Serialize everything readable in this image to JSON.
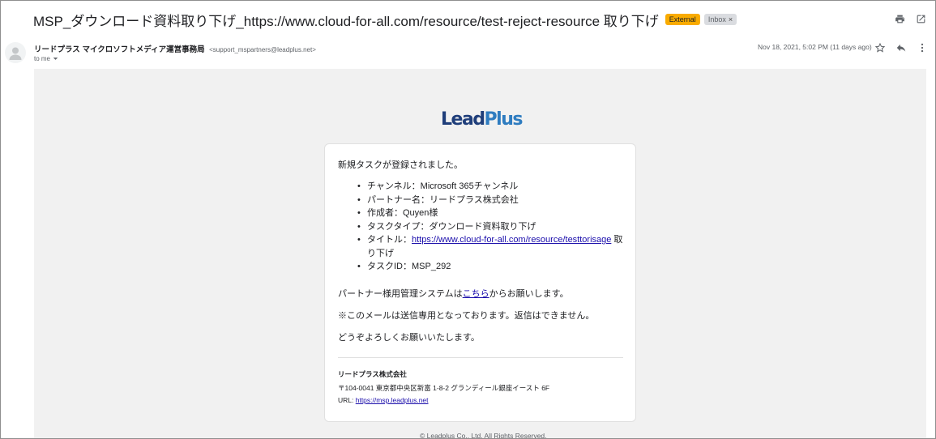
{
  "email": {
    "subject": "MSP_ダウンロード資料取り下げ_https://www.cloud-for-all.com/resource/test-reject-resource 取り下げ",
    "labels": {
      "external": "External",
      "inbox": "Inbox",
      "inbox_remove": "×"
    },
    "top_icons": [
      "print-icon",
      "open-in-new-window-icon"
    ],
    "sender": {
      "name": "リードプラス マイクロソフトメディア運営事務局",
      "email": "<support_mspartners@leadplus.net>",
      "to": "to me",
      "date": "Nov 18, 2021, 5:02 PM (11 days ago)"
    },
    "sender_icons": [
      "star-icon",
      "reply-icon",
      "more-vert-icon"
    ]
  },
  "body": {
    "logo": {
      "lead": "Lead",
      "plus": "Plus"
    },
    "intro": "新規タスクが登録されました。",
    "items": [
      "チャンネル：Microsoft 365チャンネル",
      "パートナー名：リードプラス株式会社",
      "作成者：Quyen様",
      "タスクタイプ：ダウンロード資料取り下げ"
    ],
    "title_item": {
      "prefix": "タイトル：",
      "link": "https://www.cloud-for-all.com/resource/testtorisage",
      "suffix": " 取り下げ"
    },
    "task_id": "タスクID：MSP_292",
    "system_line": {
      "before": "パートナー様用管理システムは",
      "link": "こちら",
      "after": "からお願いします。"
    },
    "note": "※このメールは送信専用となっております。返信はできません。",
    "closing": "どうぞよろしくお願いいたします。",
    "footer": {
      "company": "リードプラス株式会社",
      "address": "〒104-0041 東京都中央区新富 1-8-2 グランディール銀座イースト 6F",
      "url_label": "URL: ",
      "url": "https://msp.leadplus.net"
    },
    "copyright": "© Leadplus Co., Ltd. All Rights Reserved."
  }
}
